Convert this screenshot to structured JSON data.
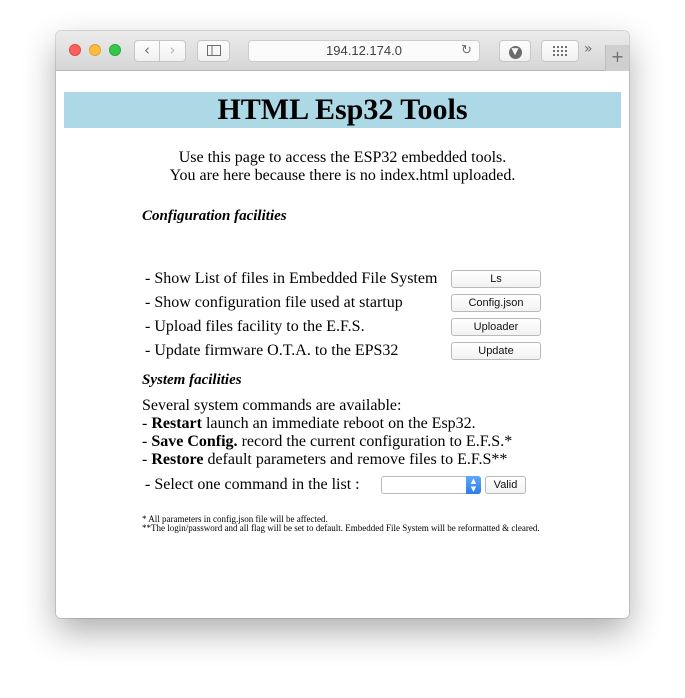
{
  "browser": {
    "address": "194.12.174.0",
    "icons": {
      "back": "chevron-left-icon",
      "forward": "chevron-right-icon",
      "sidebar": "sidebar-icon",
      "reload": "reload-icon",
      "download": "download-icon",
      "tabs": "tab-overview-icon",
      "more": "chevron-double-right-icon",
      "new_tab": "plus-icon"
    }
  },
  "page": {
    "title": "HTML Esp32 Tools",
    "banner_color": "#add8e6",
    "intro_line1": "Use this page to access the ESP32 embedded tools.",
    "intro_line2": "You are here because there is no index.html uploaded.",
    "config_title": "Configuration facilities",
    "config_items": [
      {
        "label": "- Show List of files in Embedded File System",
        "button": "Ls"
      },
      {
        "label": "- Show configuration file used at startup",
        "button": "Config.json"
      },
      {
        "label": "- Upload files facility to the E.F.S.",
        "button": "Uploader"
      },
      {
        "label": "- Update firmware O.T.A. to the EPS32",
        "button": "Update"
      }
    ],
    "system_title": "System facilities",
    "system_intro": "Several system commands are available:",
    "commands": [
      {
        "prefix": "- ",
        "name": "Restart",
        "desc": " launch an immediate reboot on the Esp32."
      },
      {
        "prefix": "- ",
        "name": "Save Config.",
        "desc": " record the current configuration to E.F.S.*"
      },
      {
        "prefix": "- ",
        "name": "Restore",
        "desc": " default parameters and remove files to E.F.S**"
      }
    ],
    "select_label": "- Select one command in the list :",
    "select_value": "",
    "valid_button": "Valid",
    "note1": "* All parameters in config.json file will be affected.",
    "note2": "**The login/password and all flag will be set to default. Embedded File System will be reformatted & cleared."
  }
}
